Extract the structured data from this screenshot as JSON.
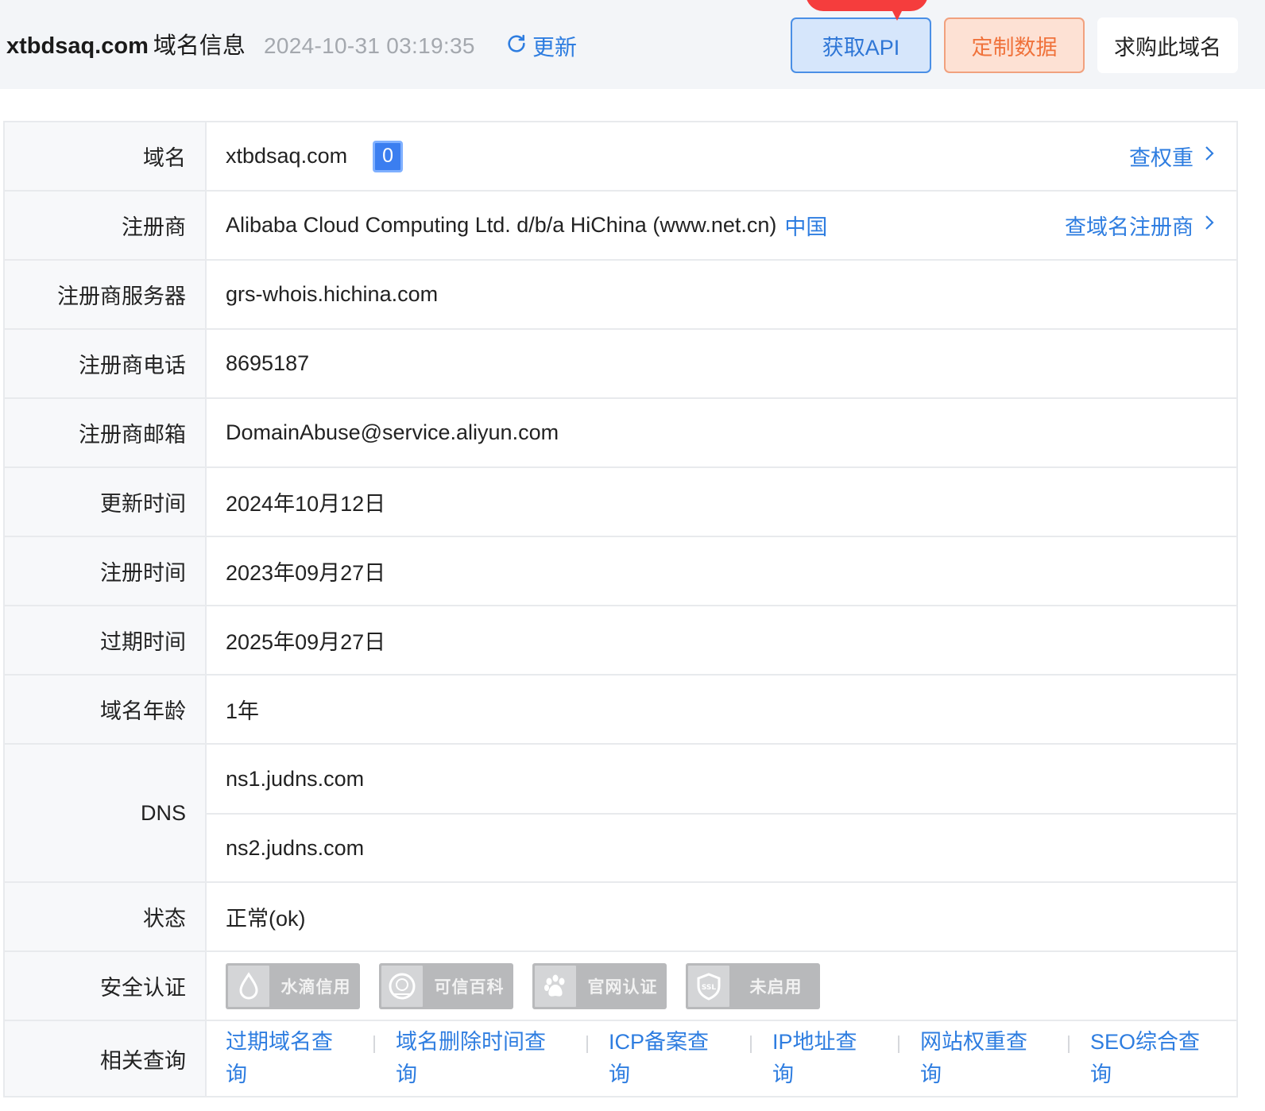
{
  "header": {
    "domain": "xtbdsaq.com",
    "title_suffix": "域名信息",
    "timestamp": "2024-10-31 03:19:35",
    "refresh_label": "更新",
    "buttons": {
      "api": "获取API",
      "custom": "定制数据",
      "buy": "求购此域名"
    }
  },
  "info": {
    "domain": {
      "label": "域名",
      "value": "xtbdsaq.com",
      "badge": "0",
      "link": "查权重"
    },
    "registrar": {
      "label": "注册商",
      "value": "Alibaba Cloud Computing Ltd. d/b/a HiChina (www.net.cn)",
      "country": "中国",
      "link": "查域名注册商"
    },
    "registrar_server": {
      "label": "注册商服务器",
      "value": "grs-whois.hichina.com"
    },
    "registrar_phone": {
      "label": "注册商电话",
      "value": "8695187"
    },
    "registrar_email": {
      "label": "注册商邮箱",
      "value": "DomainAbuse@service.aliyun.com"
    },
    "updated": {
      "label": "更新时间",
      "value": "2024年10月12日"
    },
    "registered": {
      "label": "注册时间",
      "value": "2023年09月27日"
    },
    "expires": {
      "label": "过期时间",
      "value": "2025年09月27日"
    },
    "age": {
      "label": "域名年龄",
      "value": "1年"
    },
    "dns": {
      "label": "DNS",
      "values": [
        "ns1.judns.com",
        "ns2.judns.com"
      ]
    },
    "status": {
      "label": "状态",
      "value": "正常(ok)"
    },
    "security": {
      "label": "安全认证",
      "badges": [
        {
          "text": "水滴信用",
          "icon": "water-drop-icon"
        },
        {
          "text": "可信百科",
          "icon": "baike-seal-icon"
        },
        {
          "text": "官网认证",
          "icon": "paw-icon"
        },
        {
          "text": "未启用",
          "icon": "ssl-shield-icon"
        }
      ]
    },
    "related": {
      "label": "相关查询",
      "items": [
        "过期域名查询",
        "域名删除时间查询",
        "ICP备案查询",
        "IP地址查询",
        "网站权重查询",
        "SEO综合查询"
      ]
    }
  },
  "colors": {
    "link": "#2e7de0",
    "api_button_bg": "#d6e6fb",
    "custom_button_bg": "#fde1d4",
    "hot_badge": "#f53d3d"
  }
}
